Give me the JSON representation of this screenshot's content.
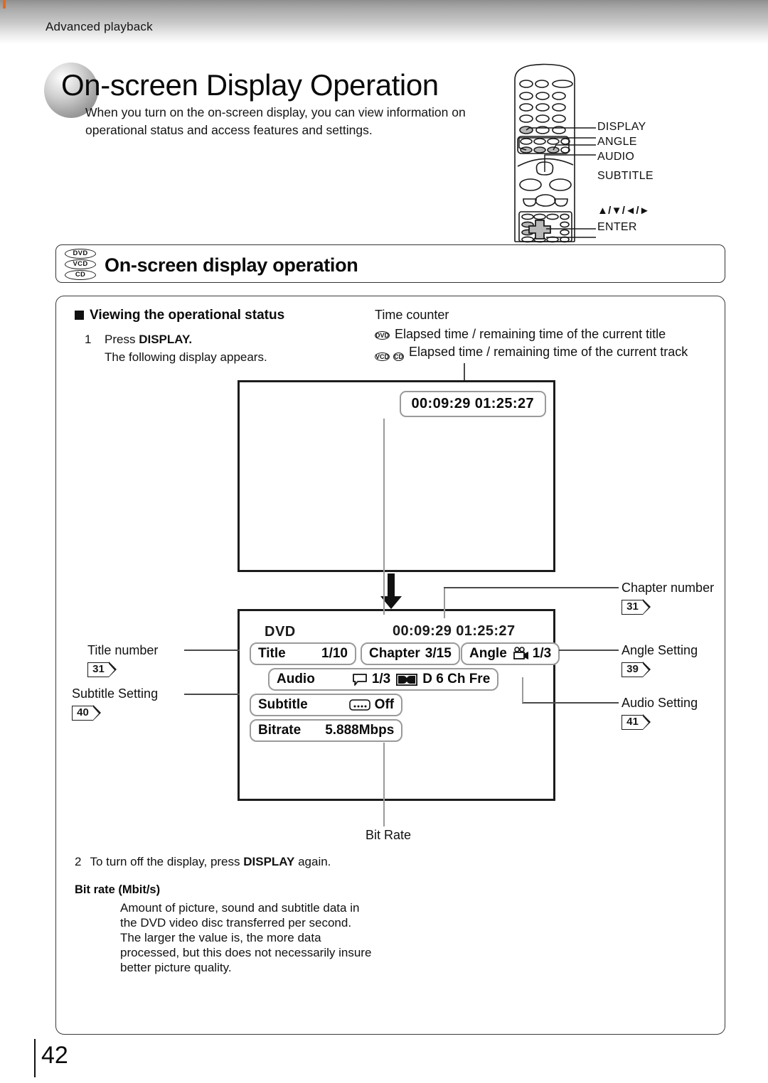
{
  "header": {
    "running_head": "Advanced playback"
  },
  "chapter": {
    "title": "On-screen Display Operation",
    "intro": "When you turn on the on-screen display, you can view information on operational status and access features and settings."
  },
  "remote": {
    "callouts": [
      {
        "label": "DISPLAY"
      },
      {
        "label": "ANGLE"
      },
      {
        "label": "AUDIO"
      },
      {
        "label": "SUBTITLE"
      },
      {
        "label": "▲/▼/◄/►"
      },
      {
        "label": "ENTER"
      }
    ]
  },
  "section": {
    "title": "On-screen display operation",
    "discs": [
      "DVD",
      "VCD",
      "CD"
    ]
  },
  "body": {
    "subhead": "Viewing the operational status",
    "step1_num": "1",
    "step1_line1_pre": "Press ",
    "step1_line1_bold": "DISPLAY.",
    "step1_line2": "The following display appears.",
    "step2_num": "2",
    "step2_pre": "To turn off the display, press ",
    "step2_bold": "DISPLAY",
    "step2_post": " again.",
    "bitrate_head": "Bit rate (Mbit/s)",
    "bitrate_body": "Amount of picture, sound and subtitle data in\nthe DVD video disc transferred per second.\nThe larger the value is, the more data\nprocessed, but this does not necessarily insure\nbetter picture quality."
  },
  "time_counter": {
    "title": "Time counter",
    "rows": [
      {
        "badges": [
          "DVD"
        ],
        "text": "Elapsed time / remaining time of the current title"
      },
      {
        "badges": [
          "VCD",
          "CD"
        ],
        "text": "Elapsed time / remaining time of the current track"
      }
    ]
  },
  "osd_simple": {
    "time": "00:09:29  01:25:27"
  },
  "osd_detail": {
    "disc_type": "DVD",
    "time": "00:09:29  01:25:27",
    "title_label": "Title",
    "title_value": "1/10",
    "chapter_label": "Chapter",
    "chapter_value": "3/15",
    "angle_label": "Angle",
    "angle_value": "1/3",
    "angle_icon": "movie-camera-icon",
    "audio_label": "Audio",
    "audio_icon": "speech-bubble-icon",
    "audio_track": "1/3",
    "audio_format_icon": "dolby-digital-icon",
    "audio_format": "D  6 Ch  Fre",
    "subtitle_label": "Subtitle",
    "subtitle_icon": "subtitle-box-icon",
    "subtitle_value": "Off",
    "bitrate_label": "Bitrate",
    "bitrate_value": "5.888Mbps"
  },
  "callouts": {
    "left": [
      {
        "label": "Title number",
        "page": "31"
      },
      {
        "label": "Subtitle Setting",
        "page": "40"
      }
    ],
    "right": [
      {
        "label": "Chapter number",
        "page": "31"
      },
      {
        "label": "Angle Setting",
        "page": "39"
      },
      {
        "label": "Audio Setting",
        "page": "41"
      }
    ],
    "bottom": {
      "label": "Bit Rate"
    }
  },
  "folio": {
    "page_number": "42"
  },
  "colors": {
    "accent_tick": "#e06a20",
    "rule": "#1b1b1b",
    "pill_border": "#9a9a9a"
  }
}
